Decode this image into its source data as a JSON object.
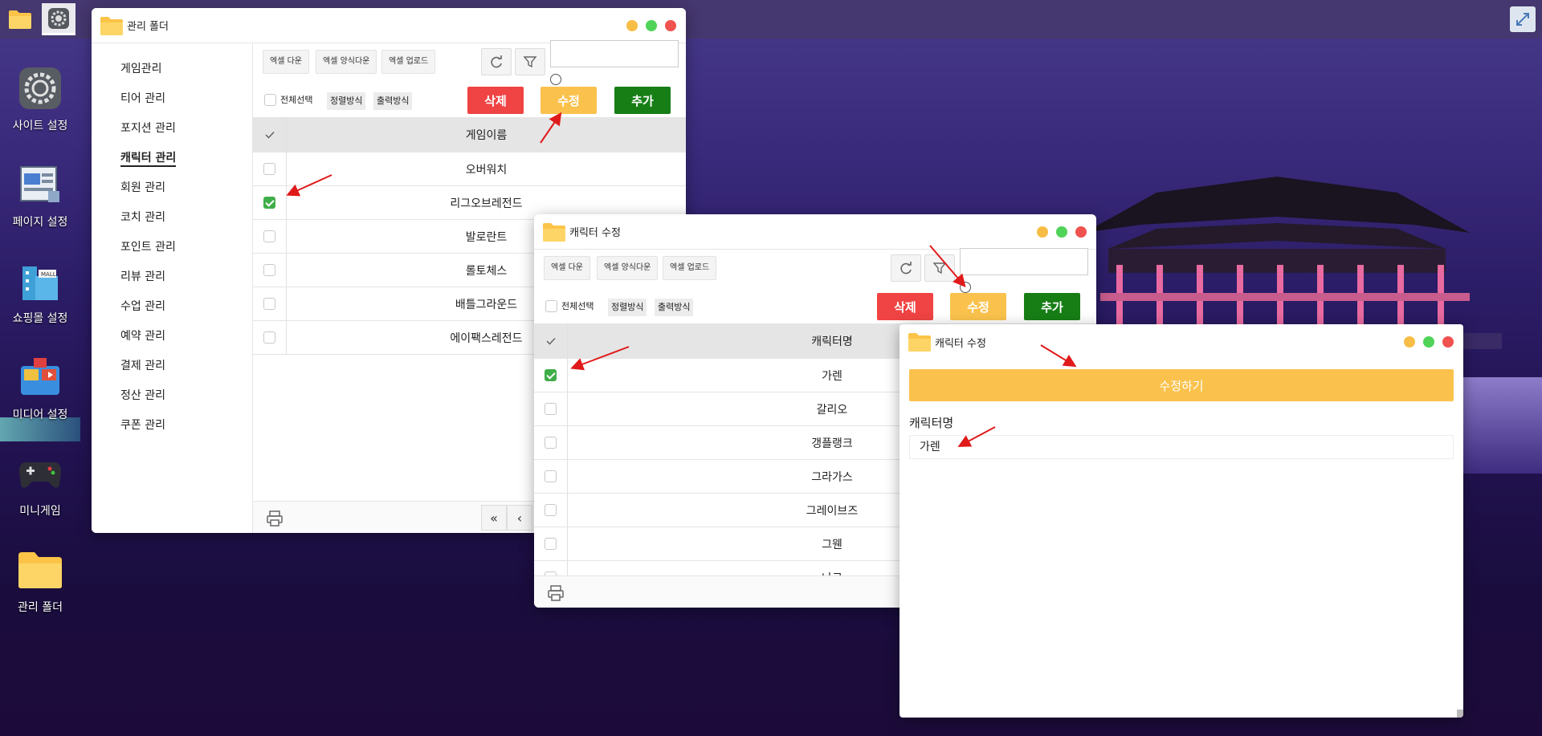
{
  "desktop": {
    "icons": [
      {
        "label": "사이트 설정",
        "icon": "gear-icon"
      },
      {
        "label": "페이지 설정",
        "icon": "page-icon"
      },
      {
        "label": "쇼핑몰 설정",
        "icon": "mall-icon"
      },
      {
        "label": "미디어 설정",
        "icon": "media-icon"
      },
      {
        "label": "미니게임",
        "icon": "gamepad-icon"
      },
      {
        "label": "관리 폴더",
        "icon": "folder-icon"
      }
    ]
  },
  "window1": {
    "title": "관리 폴더",
    "sidebar": [
      "게임관리",
      "티어 관리",
      "포지션 관리",
      "캐릭터 관리",
      "회원 관리",
      "코치 관리",
      "포인트 관리",
      "리뷰 관리",
      "수업 관리",
      "예약 관리",
      "결제 관리",
      "정산 관리",
      "쿠폰 관리"
    ],
    "selected_sidebar": "캐릭터 관리",
    "toolbar": {
      "excel_down": "엑셀 다운",
      "excel_form_down": "엑셀 양식다운",
      "excel_upload": "엑셀 업로드"
    },
    "select_all": "전체선택",
    "sort": "정렬방식",
    "print_mode": "출력방식",
    "buttons": {
      "delete": "삭제",
      "edit": "수정",
      "add": "추가"
    },
    "column": "게임이름",
    "rows": [
      {
        "name": "오버워치",
        "checked": false
      },
      {
        "name": "리그오브레전드",
        "checked": true
      },
      {
        "name": "발로란트",
        "checked": false
      },
      {
        "name": "롤토체스",
        "checked": false
      },
      {
        "name": "배틀그라운드",
        "checked": false
      },
      {
        "name": "에이팩스레전드",
        "checked": false
      }
    ]
  },
  "window2": {
    "title": "캐릭터 수정",
    "toolbar": {
      "excel_down": "엑셀 다운",
      "excel_form_down": "엑셀 양식다운",
      "excel_upload": "엑셀 업로드"
    },
    "select_all": "전체선택",
    "sort": "정렬방식",
    "print_mode": "출력방식",
    "buttons": {
      "delete": "삭제",
      "edit": "수정",
      "add": "추가"
    },
    "column": "캐릭터명",
    "rows": [
      {
        "name": "가렌",
        "checked": true
      },
      {
        "name": "갈리오",
        "checked": false
      },
      {
        "name": "갱플랭크",
        "checked": false
      },
      {
        "name": "그라가스",
        "checked": false
      },
      {
        "name": "그레이브즈",
        "checked": false
      },
      {
        "name": "그웬",
        "checked": false
      },
      {
        "name": "나르",
        "checked": false
      }
    ]
  },
  "window3": {
    "title": "캐릭터 수정",
    "submit": "수정하기",
    "field_label": "캐릭터명",
    "field_value": "가렌"
  },
  "colors": {
    "delete": "#f04343",
    "edit": "#fac24d",
    "add": "#177e16",
    "check": "#3fae49",
    "arrow": "#e01a1a"
  }
}
